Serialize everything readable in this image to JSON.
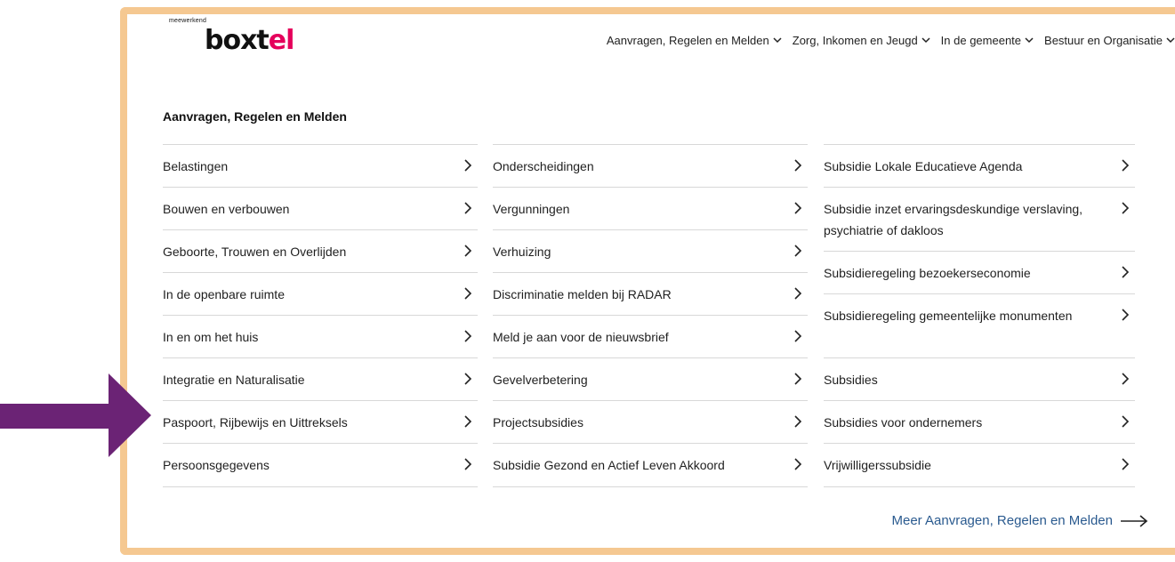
{
  "logo": {
    "small_text": "meewerkend",
    "word_main": "boxt",
    "word_accent": "el"
  },
  "topnav": [
    {
      "label": "Aanvragen, Regelen en Melden"
    },
    {
      "label": "Zorg, Inkomen en Jeugd"
    },
    {
      "label": "In de gemeente"
    },
    {
      "label": "Bestuur en Organisatie"
    }
  ],
  "section": {
    "heading": "Aanvragen, Regelen en Melden",
    "columns": [
      {
        "items": [
          {
            "label": "Belastingen"
          },
          {
            "label": "Bouwen en verbouwen"
          },
          {
            "label": "Geboorte, Trouwen en Overlijden"
          },
          {
            "label": "In de openbare ruimte"
          },
          {
            "label": "In en om het huis"
          },
          {
            "label": "Integratie en Naturalisatie"
          },
          {
            "label": "Paspoort, Rijbewijs en Uittreksels"
          },
          {
            "label": "Persoonsgegevens"
          }
        ]
      },
      {
        "items": [
          {
            "label": "Onderscheidingen"
          },
          {
            "label": "Vergunningen"
          },
          {
            "label": "Verhuizing"
          },
          {
            "label": "Discriminatie melden bij RADAR"
          },
          {
            "label": "Meld je aan voor de nieuwsbrief"
          },
          {
            "label": "Gevelverbetering"
          },
          {
            "label": "Projectsubsidies"
          },
          {
            "label": "Subsidie Gezond en Actief Leven Akkoord"
          }
        ]
      },
      {
        "items": [
          {
            "label": "Subsidie Lokale Educatieve Agenda"
          },
          {
            "label": "Subsidie inzet ervaringsdeskundige verslaving, psychiatrie of dakloos"
          },
          {
            "label": "Subsidieregeling bezoekerseconomie"
          },
          {
            "label": "Subsidieregeling gemeentelijke monumenten"
          },
          {
            "label": "Subsidies"
          },
          {
            "label": "Subsidies voor ondernemers"
          },
          {
            "label": "Vrijwilligerssubsidie"
          }
        ]
      }
    ],
    "more_link": "Meer Aanvragen, Regelen en Melden"
  },
  "annotation": {
    "arrow_color": "#6b2375",
    "icon": "arrow-right-icon"
  },
  "colors": {
    "frame": "#f5c891",
    "link": "#2a5a8f",
    "logo_accent": "#e5005b"
  }
}
